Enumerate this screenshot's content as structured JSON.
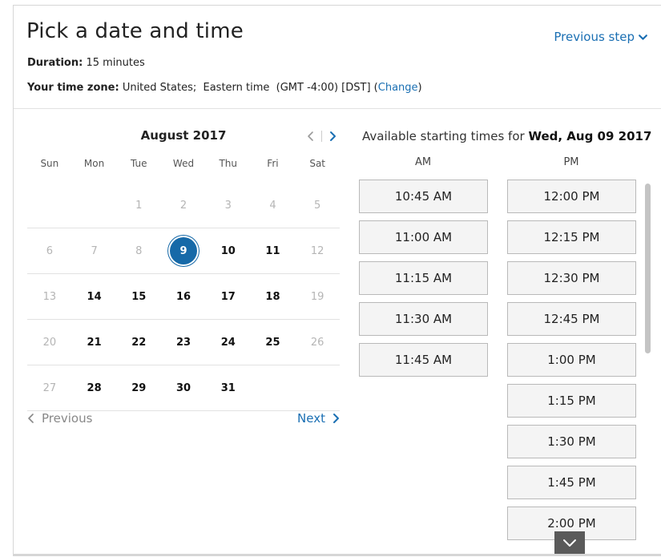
{
  "header": {
    "title": "Pick a date and time",
    "previous_step": "Previous step",
    "duration_label": "Duration:",
    "duration_value": "15 minutes",
    "timezone_label": "Your time zone:",
    "timezone_value": "United States;  Eastern time  (GMT -4:00) [DST]",
    "change_open": "(",
    "change_link": "Change",
    "change_close": ")"
  },
  "calendar": {
    "month": "August 2017",
    "days_of_week": [
      "Sun",
      "Mon",
      "Tue",
      "Wed",
      "Thu",
      "Fri",
      "Sat"
    ],
    "weeks": [
      [
        {
          "d": "",
          "s": "empty"
        },
        {
          "d": "",
          "s": "empty"
        },
        {
          "d": "1",
          "s": "disabled"
        },
        {
          "d": "2",
          "s": "disabled"
        },
        {
          "d": "3",
          "s": "disabled"
        },
        {
          "d": "4",
          "s": "disabled"
        },
        {
          "d": "5",
          "s": "disabled"
        }
      ],
      [
        {
          "d": "6",
          "s": "disabled"
        },
        {
          "d": "7",
          "s": "disabled"
        },
        {
          "d": "8",
          "s": "disabled"
        },
        {
          "d": "9",
          "s": "selected"
        },
        {
          "d": "10",
          "s": "avail"
        },
        {
          "d": "11",
          "s": "avail"
        },
        {
          "d": "12",
          "s": "disabled"
        }
      ],
      [
        {
          "d": "13",
          "s": "disabled"
        },
        {
          "d": "14",
          "s": "avail"
        },
        {
          "d": "15",
          "s": "avail"
        },
        {
          "d": "16",
          "s": "avail"
        },
        {
          "d": "17",
          "s": "avail"
        },
        {
          "d": "18",
          "s": "avail"
        },
        {
          "d": "19",
          "s": "disabled"
        }
      ],
      [
        {
          "d": "20",
          "s": "disabled"
        },
        {
          "d": "21",
          "s": "avail"
        },
        {
          "d": "22",
          "s": "avail"
        },
        {
          "d": "23",
          "s": "avail"
        },
        {
          "d": "24",
          "s": "avail"
        },
        {
          "d": "25",
          "s": "avail"
        },
        {
          "d": "26",
          "s": "disabled"
        }
      ],
      [
        {
          "d": "27",
          "s": "disabled"
        },
        {
          "d": "28",
          "s": "avail"
        },
        {
          "d": "29",
          "s": "avail"
        },
        {
          "d": "30",
          "s": "avail"
        },
        {
          "d": "31",
          "s": "avail"
        },
        {
          "d": "",
          "s": "empty"
        },
        {
          "d": "",
          "s": "empty"
        }
      ]
    ],
    "prev_label": "Previous",
    "next_label": "Next",
    "selected_color": "#1669a8"
  },
  "times": {
    "heading_prefix": "Available starting times for",
    "heading_date": "Wed, Aug 09 2017",
    "am_label": "AM",
    "pm_label": "PM",
    "am_slots": [
      "10:45 AM",
      "11:00 AM",
      "11:15 AM",
      "11:30 AM",
      "11:45 AM"
    ],
    "pm_slots": [
      "12:00 PM",
      "12:15 PM",
      "12:30 PM",
      "12:45 PM",
      "1:00 PM",
      "1:15 PM",
      "1:30 PM",
      "1:45 PM",
      "2:00 PM"
    ]
  },
  "colors": {
    "link": "#1a6fb3",
    "disabled_day": "#b5b5b5",
    "slot_bg": "#f4f4f4",
    "slot_border": "#b9b9b9"
  }
}
